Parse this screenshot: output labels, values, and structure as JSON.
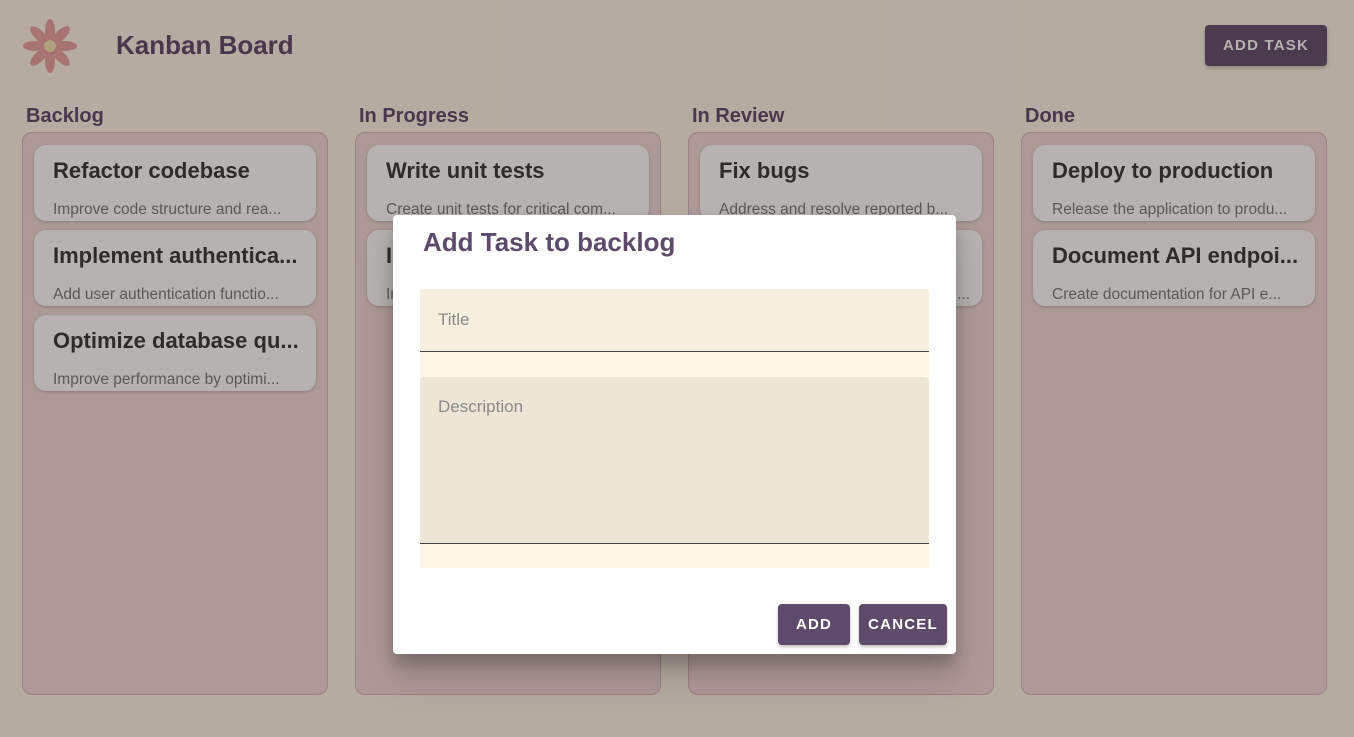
{
  "header": {
    "title": "Kanban Board",
    "add_task_label": "ADD TASK",
    "logo_icon": "flower-icon"
  },
  "columns": [
    {
      "title": "Backlog",
      "cards": [
        {
          "title": "Refactor codebase",
          "desc": "Improve code structure and rea..."
        },
        {
          "title": "Implement authentica...",
          "desc": "Add user authentication functio..."
        },
        {
          "title": "Optimize database qu...",
          "desc": "Improve performance by optimi..."
        }
      ]
    },
    {
      "title": "In Progress",
      "cards": [
        {
          "title": "Write unit tests",
          "desc": "Create unit tests for critical com..."
        },
        {
          "title": "I",
          "desc": "Ir"
        }
      ]
    },
    {
      "title": "In Review",
      "cards": [
        {
          "title": "Fix bugs",
          "desc": "Address and resolve reported b..."
        },
        {
          "title": "",
          "desc": "..."
        }
      ]
    },
    {
      "title": "Done",
      "cards": [
        {
          "title": "Deploy to production",
          "desc": "Release the application to produ..."
        },
        {
          "title": "Document API endpoi...",
          "desc": "Create documentation for API e..."
        }
      ]
    }
  ],
  "dialog": {
    "title": "Add Task to backlog",
    "title_placeholder": "Title",
    "description_placeholder": "Description",
    "add_label": "ADD",
    "cancel_label": "CANCEL"
  },
  "colors": {
    "primary": "#5e4a6a",
    "column_bg": "#f3d9d9",
    "page_bg": "#fdf5e6"
  }
}
